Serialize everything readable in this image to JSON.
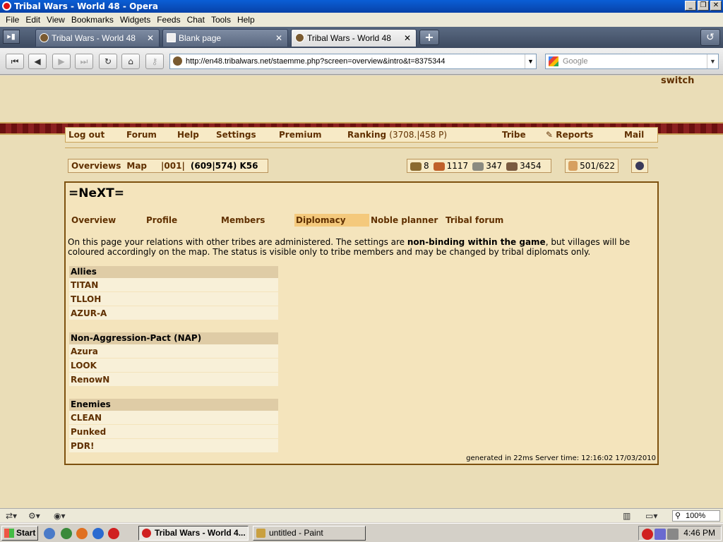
{
  "window": {
    "title": "Tribal Wars - World 48 - Opera"
  },
  "menubar": [
    "File",
    "Edit",
    "View",
    "Bookmarks",
    "Widgets",
    "Feeds",
    "Chat",
    "Tools",
    "Help"
  ],
  "tabs": [
    {
      "label": "Tribal Wars - World 48",
      "active": false
    },
    {
      "label": "Blank page",
      "active": false
    },
    {
      "label": "Tribal Wars - World 48",
      "active": true
    }
  ],
  "address": {
    "url": "http://en48.tribalwars.net/staemme.php?screen=overview&intro&t=8375344",
    "search_placeholder": "Google"
  },
  "page": {
    "switch_label": "switch",
    "topnav": {
      "logout": "Log out",
      "forum": "Forum",
      "help": "Help",
      "settings": "Settings",
      "premium": "Premium",
      "ranking": "Ranking",
      "ranking_value": "(3708.|458 P)",
      "tribe": "Tribe",
      "reports": "Reports",
      "mail": "Mail"
    },
    "village_bar": {
      "overviews": "Overviews",
      "map": "Map",
      "village_name": "|001|",
      "coords": "(609|574) K56"
    },
    "resources": {
      "premium": "8",
      "wood": "1117",
      "stone": "347",
      "iron": "3454",
      "population": "501/622"
    },
    "tribe": {
      "name": "=NeXT=",
      "tabs": [
        "Overview",
        "Profile",
        "Members",
        "Diplomacy",
        "Noble planner",
        "Tribal forum"
      ],
      "selected_tab": "Diplomacy",
      "intro_part1": "On this page your relations with other tribes are administered. The settings are ",
      "intro_bold": "non-binding within the game",
      "intro_part2": ", but villages will be coloured accordingly on the map. The status is visible only to tribe members and may be changed by tribal diplomats only.",
      "allies": {
        "header": "Allies",
        "items": [
          "TITAN",
          "TLLOH",
          "AZUR-A"
        ]
      },
      "nap": {
        "header": "Non-Aggression-Pact (NAP)",
        "items": [
          "Azura",
          "LOOK",
          "RenowN"
        ]
      },
      "enemies": {
        "header": "Enemies",
        "items": [
          "CLEAN",
          "Punked",
          "PDR!"
        ]
      },
      "footer": "generated in 22ms Server time: 12:16:02 17/03/2010"
    }
  },
  "statusbar": {
    "zoom": "100%"
  },
  "taskbar": {
    "start": "Start",
    "items": [
      "Tribal Wars - World 4...",
      "untitled - Paint"
    ],
    "clock": "4:46 PM"
  }
}
